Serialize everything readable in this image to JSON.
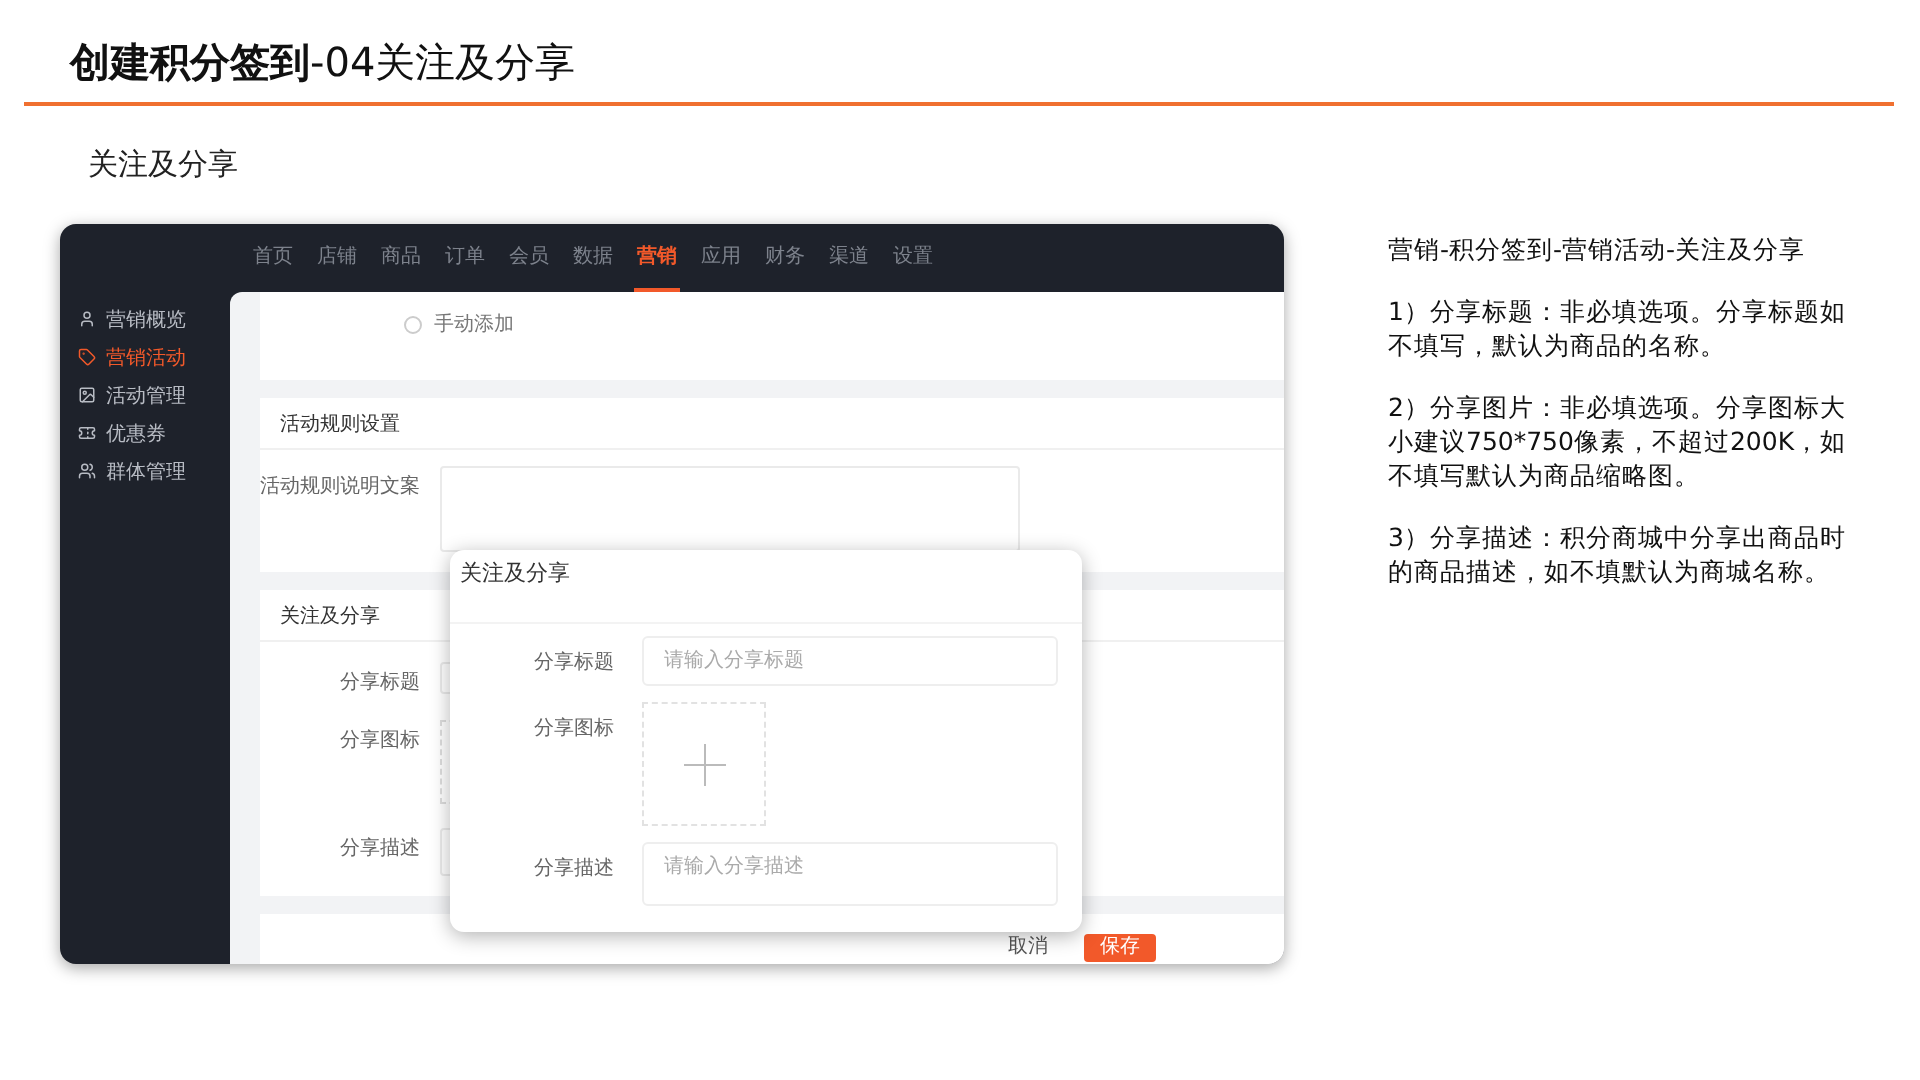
{
  "slide": {
    "title": "**创建积分签到**-04关注及分享",
    "subtitle": "关注及分享"
  },
  "app": {
    "nav": [
      {
        "label": "首页",
        "selected": false
      },
      {
        "label": "店铺",
        "selected": false
      },
      {
        "label": "商品",
        "selected": false
      },
      {
        "label": "订单",
        "selected": false
      },
      {
        "label": "会员",
        "selected": false
      },
      {
        "label": "数据",
        "selected": false
      },
      {
        "label": "营销",
        "selected": true
      },
      {
        "label": "应用",
        "selected": false
      },
      {
        "label": "财务",
        "selected": false
      },
      {
        "label": "渠道",
        "selected": false
      },
      {
        "label": "设置",
        "selected": false
      }
    ],
    "sidebar": [
      {
        "label": "营销概览",
        "selected": false
      },
      {
        "label": "营销活动",
        "selected": true
      },
      {
        "label": "活动管理",
        "selected": false
      },
      {
        "label": "优惠券",
        "selected": false
      },
      {
        "label": "群体管理",
        "selected": false
      }
    ],
    "basic_section": {
      "radio_label": "手动添加",
      "radio_checked": false
    },
    "rules_section": {
      "title": "活动规则设置",
      "field_label": "活动规则说明文案"
    },
    "share_section": {
      "title": "关注及分享",
      "fields": [
        {
          "kind": "text",
          "label": "分享标题"
        },
        {
          "kind": "upload",
          "label": "分享图标"
        },
        {
          "kind": "text",
          "label": "分享描述"
        }
      ]
    },
    "footer": {
      "buttons": [
        {
          "label": "取消",
          "primary": false
        },
        {
          "label": "保存",
          "primary": true
        }
      ]
    },
    "modal": {
      "title": "关注及分享",
      "fields": [
        {
          "kind": "text",
          "label": "分享标题",
          "placeholder": "请输入分享标题"
        },
        {
          "kind": "upload",
          "label": "分享图标"
        },
        {
          "kind": "textarea",
          "label": "分享描述",
          "placeholder": "请输入分享描述"
        }
      ]
    }
  },
  "notes": {
    "heading": "营销-积分签到-营销活动-关注及分享",
    "items": [
      "1）分享标题：非必填选项。分享标题如不填写，默认为商品的名称。",
      "2）分享图片：非必填选项。分享图标大小建议750*750像素，不超过200K，如不填写默认为商品缩略图。",
      "3）分享描述：积分商城中分享出商品时的商品描述，如不填默认为商城名称。"
    ]
  }
}
